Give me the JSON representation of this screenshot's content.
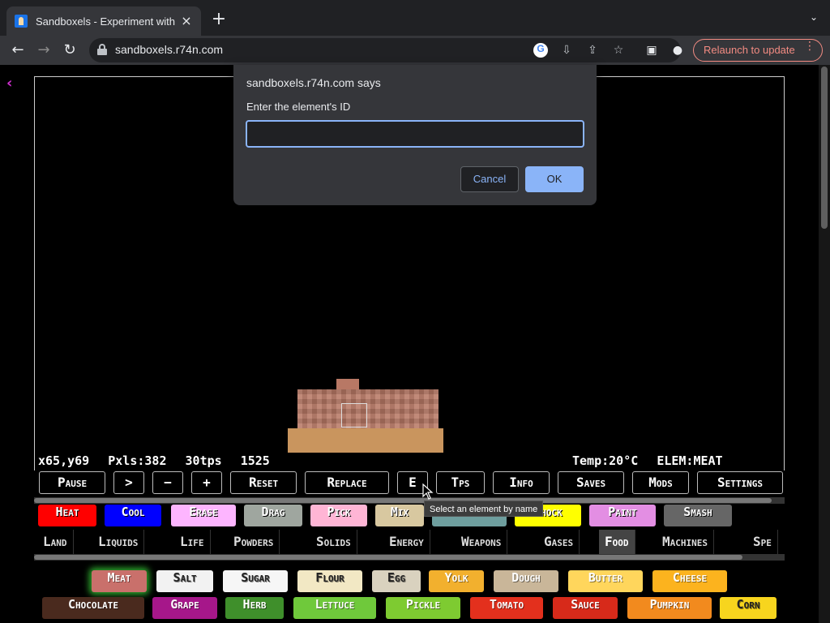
{
  "browser": {
    "tab_title": "Sandboxels - Experiment with",
    "tab_close": "×",
    "new_tab": "+",
    "tab_search": "⌄",
    "url": "sandboxels.r74n.com",
    "relaunch_label": "Relaunch to update"
  },
  "dialog": {
    "title": "sandboxels.r74n.com says",
    "message": "Enter the element's ID",
    "input_value": "",
    "cancel_label": "Cancel",
    "ok_label": "OK"
  },
  "page": {
    "back_arrow": "‹"
  },
  "status": {
    "coords": "x65,y69",
    "pixels": "Pxls:382",
    "tps": "30tps",
    "tick": "1525",
    "temp": "Temp:20°C",
    "elem": "ELEM:MEAT"
  },
  "controls": [
    {
      "label": "Pause"
    },
    {
      "label": ">"
    },
    {
      "label": "−"
    },
    {
      "label": "+"
    },
    {
      "label": "Reset"
    },
    {
      "label": "Replace"
    },
    {
      "label": "E"
    },
    {
      "label": "Tps"
    },
    {
      "label": "Info"
    },
    {
      "label": "Saves"
    },
    {
      "label": "Mods"
    },
    {
      "label": "Settings"
    }
  ],
  "tools": [
    {
      "label": "Heat",
      "color": "#ff0000"
    },
    {
      "label": "Cool",
      "color": "#0000ff"
    },
    {
      "label": "Erase",
      "color": "#fdb5ff"
    },
    {
      "label": "Drag",
      "color": "#9fa69f"
    },
    {
      "label": "Pick",
      "color": "#ffb5d5"
    },
    {
      "label": "Mix",
      "color": "#d8c8a0"
    },
    {
      "label": "Lookup",
      "color": "#6e9e9e"
    },
    {
      "label": "Shock",
      "color": "#ffff00"
    },
    {
      "label": "Paint",
      "color": "#e38ee3"
    },
    {
      "label": "Smash",
      "color": "#666666"
    }
  ],
  "tooltip": "Select an element by name",
  "categories": [
    {
      "label": "Land",
      "active": false
    },
    {
      "label": "Liquids",
      "active": false
    },
    {
      "label": "Life",
      "active": false
    },
    {
      "label": "Powders",
      "active": false
    },
    {
      "label": "Solids",
      "active": false
    },
    {
      "label": "Energy",
      "active": false
    },
    {
      "label": "Weapons",
      "active": false
    },
    {
      "label": "Gases",
      "active": false
    },
    {
      "label": "Food",
      "active": true
    },
    {
      "label": "Machines",
      "active": false
    },
    {
      "label": "Spe",
      "active": false
    }
  ],
  "elements_row1": [
    {
      "label": "Meat",
      "color": "#c9706b",
      "text": "#ffffff",
      "selected": true
    },
    {
      "label": "Salt",
      "color": "#f2f2f2",
      "text": "#222222",
      "selected": false
    },
    {
      "label": "Sugar",
      "color": "#f6f6f6",
      "text": "#222222",
      "selected": false
    },
    {
      "label": "Flour",
      "color": "#f2e8c4",
      "text": "#222222",
      "selected": false
    },
    {
      "label": "Egg",
      "color": "#d9d2bf",
      "text": "#222222",
      "selected": false
    },
    {
      "label": "Yolk",
      "color": "#f2b02e",
      "text": "#ffffff",
      "selected": false
    },
    {
      "label": "Dough",
      "color": "#c9b699",
      "text": "#ffffff",
      "selected": false
    },
    {
      "label": "Butter",
      "color": "#ffd65c",
      "text": "#ffffff",
      "selected": false
    },
    {
      "label": "Cheese",
      "color": "#fcb31e",
      "text": "#ffffff",
      "selected": false
    }
  ],
  "elements_row2": [
    {
      "label": "Chocolate",
      "color": "#4a2a1e",
      "text": "#ffffff"
    },
    {
      "label": "Grape",
      "color": "#a6178a",
      "text": "#ffffff"
    },
    {
      "label": "Herb",
      "color": "#3f8f2b",
      "text": "#ffffff"
    },
    {
      "label": "Lettuce",
      "color": "#6fc93b",
      "text": "#ffffff"
    },
    {
      "label": "Pickle",
      "color": "#7ecb31",
      "text": "#ffffff"
    },
    {
      "label": "Tomato",
      "color": "#e3301d",
      "text": "#ffffff"
    },
    {
      "label": "Sauce",
      "color": "#d72a1a",
      "text": "#ffffff"
    },
    {
      "label": "Pumpkin",
      "color": "#f28a1e",
      "text": "#ffffff"
    },
    {
      "label": "Corn",
      "color": "#f7d51e",
      "text": "#222222"
    }
  ]
}
